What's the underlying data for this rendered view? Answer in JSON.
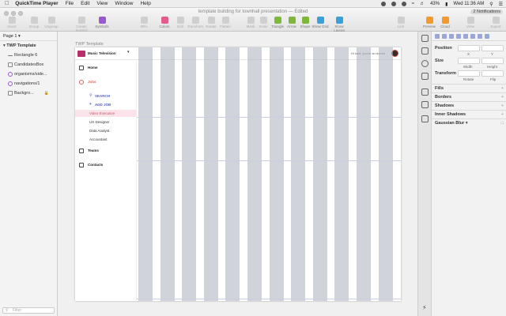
{
  "menubar": {
    "app_name": "QuickTime Player",
    "items": [
      "File",
      "Edit",
      "View",
      "Window",
      "Help"
    ],
    "battery": "43%",
    "clock": "Wed 11:36 AM"
  },
  "toolbar": {
    "title": "template building for townhall presentation — Edited",
    "notifications": "2 Notifications",
    "tools": [
      {
        "label": "Insert",
        "icon": "plus-icon"
      },
      {
        "label": "Group",
        "icon": "group-icon"
      },
      {
        "label": "Ungroup",
        "icon": "ungroup-icon"
      },
      {
        "label": "Create Symbol",
        "icon": "create-symbol-icon"
      },
      {
        "label": "Symbols",
        "icon": "symbols-icon"
      },
      {
        "label": "89%",
        "icon": "zoom-icon"
      },
      {
        "label": "Colors",
        "icon": "colors-icon"
      },
      {
        "label": "Edit",
        "icon": "edit-icon"
      },
      {
        "label": "Transform",
        "icon": "transform-icon"
      },
      {
        "label": "Rotate",
        "icon": "rotate-icon"
      },
      {
        "label": "Flatten",
        "icon": "flatten-icon"
      },
      {
        "label": "Mask",
        "icon": "mask-icon"
      },
      {
        "label": "Scale",
        "icon": "scale-icon"
      },
      {
        "label": "Triangle",
        "icon": "triangle-icon"
      },
      {
        "label": "Arrow",
        "icon": "arrow-icon"
      },
      {
        "label": "Shape",
        "icon": "shape-icon"
      },
      {
        "label": "Show Grid",
        "icon": "grid-icon"
      },
      {
        "label": "Show Layout",
        "icon": "layout-icon"
      },
      {
        "label": "Link",
        "icon": "link-icon"
      },
      {
        "label": "Preview",
        "icon": "preview-icon"
      },
      {
        "label": "Cloud",
        "icon": "cloud-icon"
      },
      {
        "label": "View",
        "icon": "view-icon"
      },
      {
        "label": "Export",
        "icon": "export-icon"
      }
    ]
  },
  "layers": {
    "page": "Page 1",
    "group": "TWP Template",
    "items": [
      {
        "label": "Rectangle 6",
        "icon": "line-icon"
      },
      {
        "label": "CandidatesBox",
        "icon": "rectangle-icon"
      },
      {
        "label": "organisms/side...",
        "icon": "symbol-icon"
      },
      {
        "label": "navigations/1",
        "icon": "symbol-icon"
      },
      {
        "label": "Backgro...",
        "icon": "rectangle-icon"
      }
    ],
    "filter_placeholder": "Filter"
  },
  "artboard": {
    "label": "TWP Template",
    "brand": "Music Television",
    "greeting": "Hi kaid, you're an Admin",
    "nav": {
      "home": "Home",
      "jobs": "Jobs",
      "search": "SEARCH",
      "add_job": "ADD JOB",
      "jobs_list": [
        "Video Executive",
        "UX Designer",
        "Data Analyst",
        "Accountant"
      ],
      "teams": "Teams",
      "contacts": "Contacts"
    }
  },
  "inspector": {
    "position": "Position",
    "x": "X",
    "y": "Y",
    "size": "Size",
    "width": "Width",
    "height": "Height",
    "transform": "Transform",
    "rotate": "Rotate",
    "flip": "Flip",
    "sections": [
      "Fills",
      "Borders",
      "Shadows",
      "Inner Shadows",
      "Gaussian Blur"
    ]
  },
  "colors": {
    "grid_column": "#aaafb9",
    "selected_row": "#fbe3ea",
    "accent": "#5460c9",
    "jobs": "#d36b5b"
  }
}
